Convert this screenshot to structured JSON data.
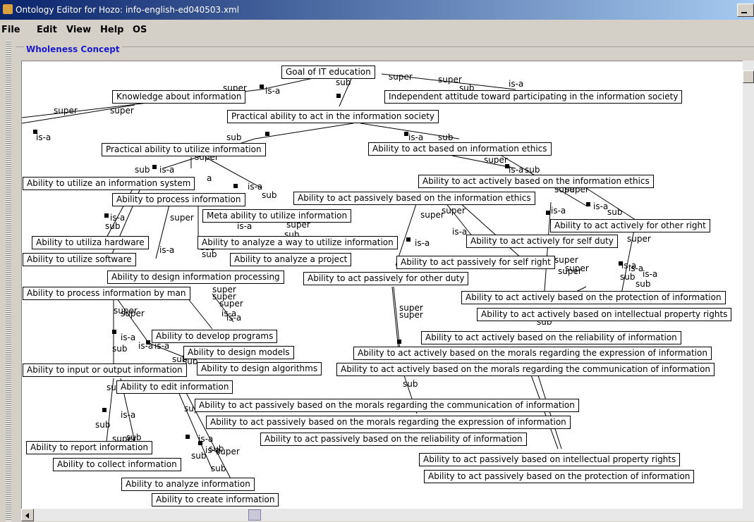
{
  "window": {
    "title": "Ontology Editor for Hozo: info-english-ed040503.xml"
  },
  "menu": [
    "File",
    "Edit",
    "View",
    "Help",
    "OS"
  ],
  "panel": {
    "title": "Wholeness Concept"
  },
  "nodes": [
    "Goal of IT education",
    "Knowledge about information",
    "Independent attitude toward participating in the information society",
    "Practical ability to act in the information society",
    "Practical ability to utilize information",
    "Ability to act based on information ethics",
    "Ability to utilize an information system",
    "Ability to process information",
    "Ability to act actively based on the information ethics",
    "Ability to act passively based on the information ethics",
    "Meta ability to utilize information",
    "Ability to act actively for other right",
    "Ability to utiliza hardware",
    "Ability to analyze a way to utilize information",
    "Ability to act actively for self duty",
    "Ability to utilize software",
    "Ability to analyze a project",
    "Ability to act passively for self right",
    "Ability to design information processing",
    "Ability to act passively for other duty",
    "Ability to process information by man",
    "Ability to act actively based on the protection of information",
    "Ability to act actively based on intellectual property rights",
    "Ability to develop programs",
    "Ability to act actively based on the reliability of information",
    "Ability to design models",
    "Ability to act actively based on the morals regarding the expression of information",
    "Ability to input or output information",
    "Ability to design algorithms",
    "Ability to act actively based on the morals regarding the communication of information",
    "Ability to edit information",
    "Ability to act passively based on the morals regarding the communication of information",
    "Ability to act passively based on the morals regarding the expression of information",
    "Ability to act passively based on the reliability of information",
    "Ability to report information",
    "Ability to collect information",
    "Ability to act passively based on intellectual property rights",
    "Ability to act passively based on the protection of information",
    "Ability to analyze information",
    "Ability to create information"
  ],
  "edge_labels": [
    "super",
    "sub",
    "is-a",
    "sub",
    "super",
    "super",
    "is-a",
    "sub",
    "super",
    "super",
    "is-a",
    "sub",
    "is-a",
    "sub",
    "is-a",
    "sub",
    "sub",
    "is-a",
    "super",
    "super",
    "super",
    "is-a",
    "sub",
    "is-a",
    "a",
    "sub",
    "is-a",
    "sub",
    "is-a",
    "super",
    "super",
    "super",
    "super",
    "is-a",
    "is-a",
    "sub",
    "is-a",
    "super",
    "super",
    "is-a",
    "sub",
    "super",
    "super",
    "is-a",
    "sub",
    "super",
    "super",
    "is-a",
    "sub",
    "is-a",
    "sub",
    "super",
    "super",
    "is-a",
    "sub",
    "is-a",
    "sub",
    "sub",
    "sub",
    "is-a",
    "super",
    "super",
    "super",
    "super",
    "is-a",
    "is-a",
    "sub",
    "is-a",
    "sub",
    "is-a",
    "sub",
    "sub",
    "sub",
    "super",
    "sub",
    "super",
    "super",
    "super",
    "super",
    "is-a"
  ]
}
